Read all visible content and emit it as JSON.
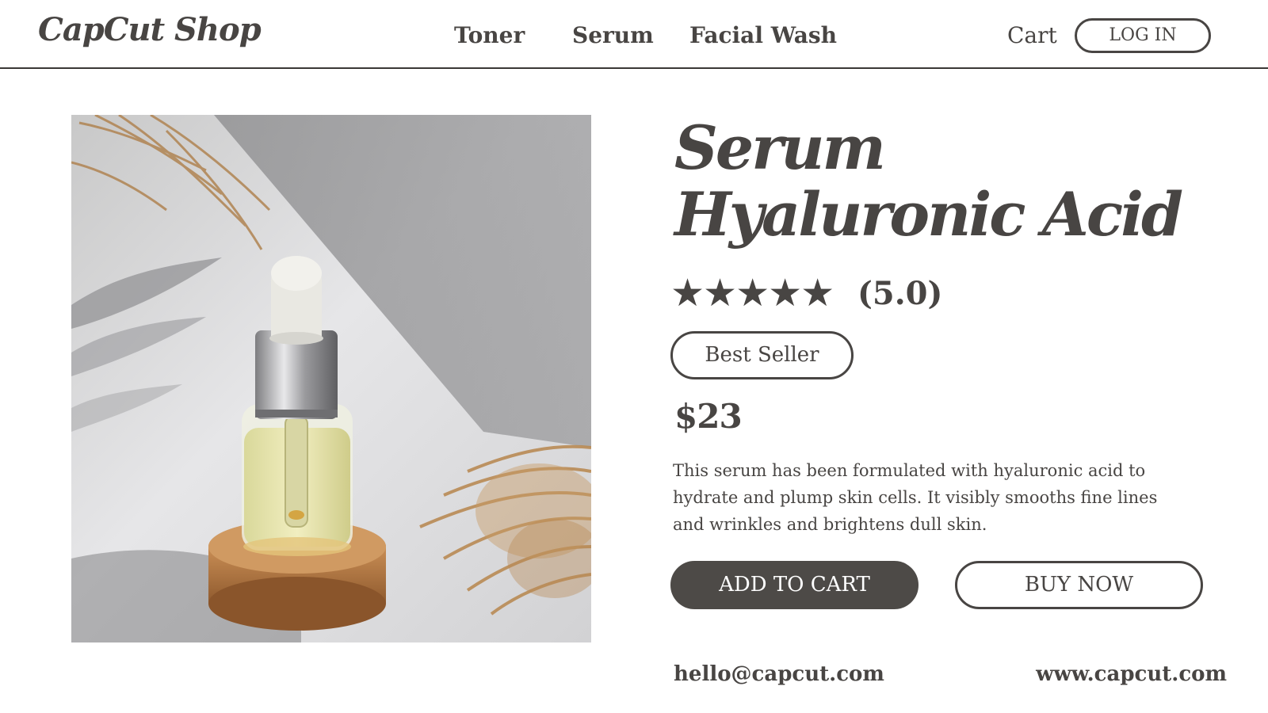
{
  "header": {
    "logo": "CapCut Shop",
    "nav": [
      {
        "label": "Toner"
      },
      {
        "label": "Serum"
      },
      {
        "label": "Facial Wash"
      }
    ],
    "cart_label": "Cart",
    "login_label": "LOG IN"
  },
  "product": {
    "title_line1": "Serum",
    "title_line2": "Hyaluronic Acid",
    "stars": "★★★★★",
    "rating": 5.0,
    "rating_text": "(5.0)",
    "badge": "Best Seller",
    "price": "$23",
    "description": "This serum has been formulated with hyaluronic acid to hydrate and plump skin cells. It visibly smooths fine lines and wrinkles and brightens dull skin.",
    "add_to_cart_label": "ADD TO CART",
    "buy_now_label": "BUY NOW"
  },
  "footer": {
    "email": "hello@capcut.com",
    "website": "www.capcut.com"
  },
  "colors": {
    "text": "#484543",
    "button_fill": "#4d4a47",
    "background": "#ffffff"
  }
}
